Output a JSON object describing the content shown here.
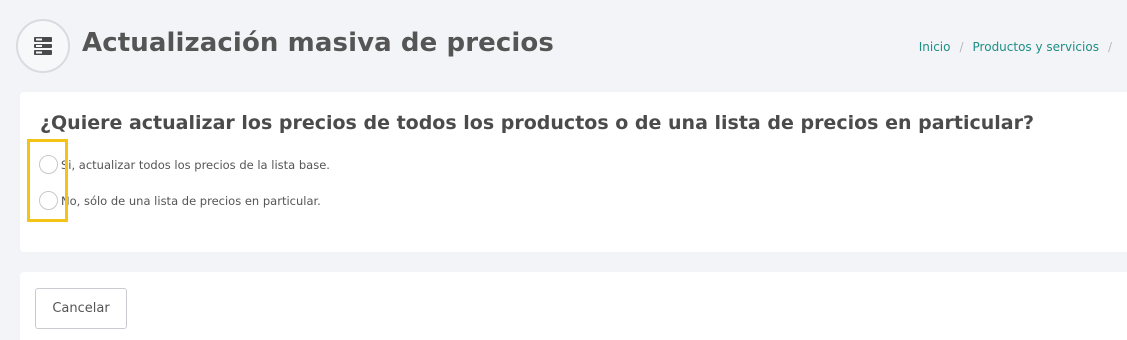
{
  "header": {
    "icon": "server-list-icon",
    "title": "Actualización masiva de precios",
    "breadcrumb": [
      {
        "label": "Inicio"
      },
      {
        "label": "Productos y servicios"
      }
    ],
    "breadcrumb_separator": "/"
  },
  "question": {
    "text": "¿Quiere actualizar los precios de todos los productos o de una lista de precios en particular?",
    "options": [
      {
        "label": "Si, actualizar todos los precios de la lista base.",
        "selected": false
      },
      {
        "label": "No, sólo de una lista de precios en particular.",
        "selected": false
      }
    ]
  },
  "footer": {
    "cancel_label": "Cancelar"
  },
  "colors": {
    "accent": "#1d8f84",
    "highlight": "#f3c316",
    "background": "#f3f4f7"
  }
}
